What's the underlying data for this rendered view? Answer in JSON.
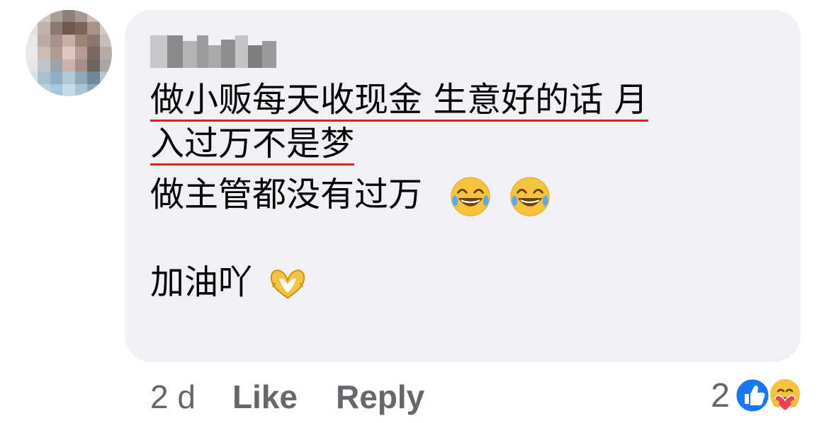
{
  "comment": {
    "author_name": "",
    "lines": [
      {
        "text": "做小贩每天收现金 生意好的话 月",
        "underlined": true
      },
      {
        "text": "入过万不是梦",
        "underlined": true
      },
      {
        "text": "做主管都没有过万",
        "underlined": false,
        "emojis": [
          "joy-emoji",
          "joy-emoji"
        ]
      },
      {
        "text": "加油吖",
        "underlined": false,
        "emojis": [
          "heart-hands-emoji"
        ]
      }
    ],
    "accent_underline_color": "#e02020"
  },
  "meta": {
    "time": "2 d",
    "like_label": "Like",
    "reply_label": "Reply"
  },
  "reactions": {
    "count": "2",
    "icons": [
      "like-reaction-icon",
      "care-reaction-icon"
    ],
    "like_color": "#1877f2"
  }
}
